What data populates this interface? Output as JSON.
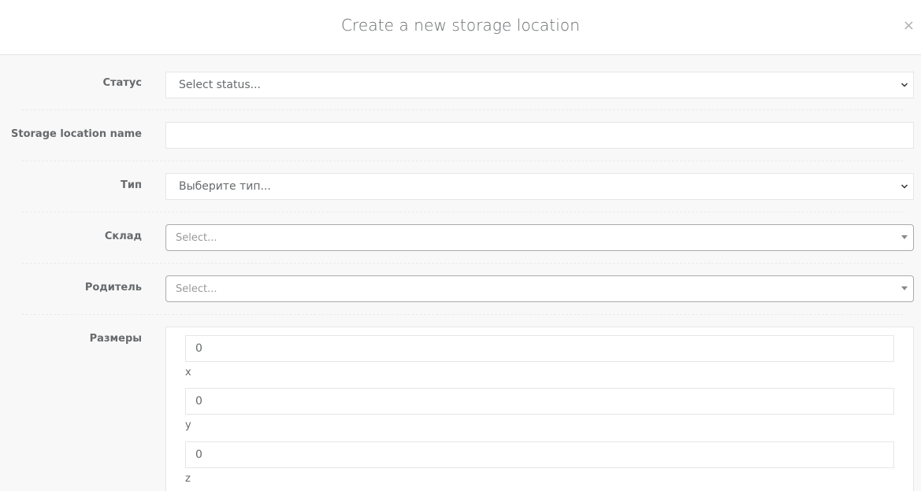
{
  "modal": {
    "title": "Create a new storage location",
    "close_glyph": "×"
  },
  "form": {
    "status": {
      "label": "Статус",
      "value": "Select status..."
    },
    "name": {
      "label": "Storage location name",
      "value": ""
    },
    "type": {
      "label": "Тип",
      "value": "Выберите тип..."
    },
    "warehouse": {
      "label": "Склад",
      "placeholder": "Select..."
    },
    "parent": {
      "label": "Родитель",
      "placeholder": "Select..."
    },
    "dimensions": {
      "label": "Размеры",
      "fields": [
        {
          "value": "0",
          "caption": "x"
        },
        {
          "value": "0",
          "caption": "y"
        },
        {
          "value": "0",
          "caption": "z"
        }
      ]
    }
  },
  "icons": {
    "select_chevron": "chevron-down-icon",
    "select2_caret": "caret-down-icon",
    "close": "close-icon"
  }
}
